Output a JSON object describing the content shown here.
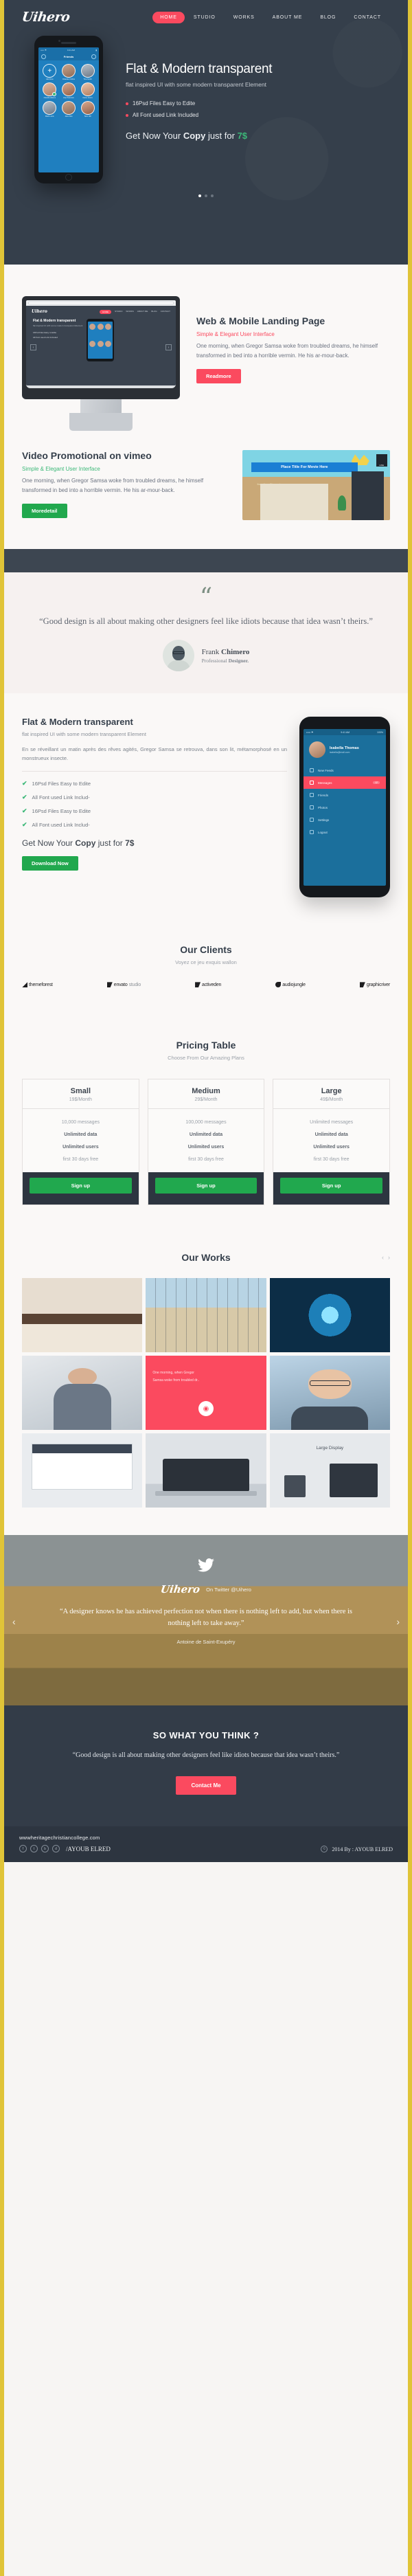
{
  "brand": {
    "logo": "Uihero",
    "accent_red": "#fb4a5f",
    "accent_green": "#3cb878",
    "dark": "#353f4b",
    "page_border": "#e0c438"
  },
  "nav": {
    "items": [
      {
        "label": "HOME",
        "active": true
      },
      {
        "label": "STUDIO",
        "active": false
      },
      {
        "label": "WORKS",
        "active": false
      },
      {
        "label": "ABOUT ME",
        "active": false
      },
      {
        "label": "BLOG",
        "active": false
      },
      {
        "label": "CONTACT",
        "active": false
      }
    ]
  },
  "hero": {
    "title": "Flat & Modern transparent",
    "subtitle": "flat inspired UI with some modern transparent Element",
    "bullets": [
      "16Psd Files Easy to Edite",
      "All Font used Link Included"
    ],
    "cta_prefix": "Get Now Your ",
    "cta_bold": "Copy",
    "cta_mid": " just for ",
    "cta_price": "7$",
    "phone": {
      "status_left": "••••• ⚑",
      "status_center": "9:41 AM",
      "status_right": "▮",
      "app_title": "Friends",
      "avatars": [
        {
          "name": "Add New",
          "add": true
        },
        {
          "name": "Chanele Collins",
          "add": false
        },
        {
          "name": "Tina Smith",
          "add": false
        },
        {
          "name": "Claudia Adams",
          "add": false
        },
        {
          "name": "Lilly Peterson",
          "add": false
        },
        {
          "name": "Nana Jeorre",
          "add": false
        },
        {
          "name": "Mark Levis",
          "add": false
        },
        {
          "name": "Jane Doe",
          "add": false
        },
        {
          "name": "Sam Hill",
          "add": false
        }
      ]
    },
    "slider_dots": 3,
    "slider_active": 0
  },
  "web_mobile": {
    "title": "Web & Mobile Landing Page",
    "subtitle": "Simple & Elegant User Interface",
    "body": "One morning, when Gregor Samsa woke from troubled dreams, he himself transformed in bed into a horrible vermin. He  his ar-mour-back.",
    "button": "Readmore",
    "mockup": {
      "logo": "Uihero",
      "nav": [
        "HOME",
        "STUDIO",
        "WORKS",
        "ABOUT ME",
        "BLOG",
        "CONTACT"
      ],
      "heading": "Flat & Modern transparent",
      "paragraph": "flat inspired UI with some modern transparent Element",
      "bullets": [
        "16Psd Files Easy to Edite",
        "All Font used Link Included"
      ],
      "prev_arrow": "‹",
      "next_arrow": "›"
    }
  },
  "video": {
    "title": "Video Promotional on vimeo",
    "subtitle": "Simple & Elegant User Interface",
    "body": "One morning, when Gregor Samsa woke from troubled dreams, he himself transformed in bed into a horrible vermin. He  his ar-mour-back.",
    "button": "Moredetail",
    "thumb_banner": "Place Title For Movie Here",
    "thumb_sub": "from Your Channel",
    "thumb_like": "LIKE"
  },
  "quote": {
    "mark": "“",
    "text": "“Good design is all about making other designers feel like idiots because that idea wasn’t theirs.”",
    "author_first": "Frank ",
    "author_last": "Chimero",
    "role_first": "Professional ",
    "role_last": "Designer."
  },
  "features": {
    "title": "Flat & Modern transparent",
    "subtitle": "flat inspired UI with some modern transparent Element",
    "paragraph": "En se réveillant un matin après des rêves agités, Gregor Samsa se retrouva, dans son lit, métamorphosé en un monstrueux insecte.",
    "checks": [
      "16Psd Files Easy to Edite",
      "All Font used Link Includ-",
      "16Psd Files Easy to Edite",
      "All Font used Link Includ-"
    ],
    "cta_prefix": "Get Now Your ",
    "cta_bold": "Copy",
    "cta_mid": " just for ",
    "cta_price": "7$",
    "button": "Download Now",
    "phone": {
      "status_left": "••••• ⚑",
      "status_center": "9:41 AM",
      "status_right": "100%",
      "profile_name": "Isabella Thomas",
      "profile_mail": "isabella@mail.com",
      "menu": [
        {
          "label": "New Feeds",
          "count": "",
          "active": false
        },
        {
          "label": "Messages",
          "count": "12",
          "active": true
        },
        {
          "label": "Friends",
          "count": "",
          "active": false
        },
        {
          "label": "Photos",
          "count": "",
          "active": false
        },
        {
          "label": "Settings",
          "count": "",
          "active": false
        },
        {
          "label": "Logout",
          "count": "",
          "active": false
        }
      ]
    }
  },
  "clients": {
    "title": "Our Clients",
    "subtitle": "Voyez ce jeu exquis wallon",
    "logos": [
      {
        "name": "themeforest",
        "bold": "themeforest",
        "lite": ""
      },
      {
        "name": "envatostudio",
        "bold": "envato",
        "lite": "studio"
      },
      {
        "name": "activeden",
        "bold": "activeden",
        "lite": ""
      },
      {
        "name": "audiojungle",
        "bold": "audiojungle",
        "lite": ""
      },
      {
        "name": "graphicriver",
        "bold": "graphicriver",
        "lite": ""
      }
    ]
  },
  "pricing": {
    "title": "Pricing Table",
    "subtitle": "Choose From Our Amazing Plans",
    "plans": [
      {
        "name": "Small",
        "price": "19$/Month",
        "features": [
          "10,000 messages",
          "Unlimited data",
          "Unlimited users",
          "first 30 days free"
        ],
        "button": "Sign up"
      },
      {
        "name": "Medium",
        "price": "29$/Month",
        "features": [
          "100,000 messages",
          "Unlimited data",
          "Unlimited users",
          "first 30 days free"
        ],
        "button": "Sign up"
      },
      {
        "name": "Large",
        "price": "49$/Month",
        "features": [
          "Unlimited messages",
          "Unlimited data",
          "Unlimited users",
          "first 30 days free"
        ],
        "button": "Sign up"
      }
    ]
  },
  "works": {
    "title": "Our Works",
    "prev": "‹",
    "next": "›",
    "items": [
      {
        "caption": ""
      },
      {
        "caption": ""
      },
      {
        "caption": ""
      },
      {
        "caption": ""
      },
      {
        "caption": "One morning, when Gregor",
        "sub": "Samsa woke from troubled dr..",
        "icon": "◉"
      },
      {
        "caption": ""
      },
      {
        "caption": ""
      },
      {
        "caption": ""
      },
      {
        "caption": "Large Display"
      }
    ]
  },
  "twitter": {
    "bird": "🐦",
    "logo": "Uihero",
    "handle": "On Twitter @Uihero",
    "quote": "“A designer knows he has achieved perfection not when there is nothing left to add, but when there is nothing left to take away.”",
    "author": "Antoine de Saint-Exupéry",
    "prev": "‹",
    "next": "›"
  },
  "think": {
    "title": "SO WHAT YOU THINK ?",
    "quote": "“Good design is all about making other designers feel like idiots because that idea wasn’t theirs.”",
    "button": "Contact Me"
  },
  "footer": {
    "site": "wwwheritagechristiancollege.com",
    "handle": "/AYOUB ELRED",
    "socials": [
      "f",
      "t",
      "b",
      "d"
    ],
    "copyright_mark": "©",
    "copyright": "2014  By : AYOUB ELRED"
  }
}
